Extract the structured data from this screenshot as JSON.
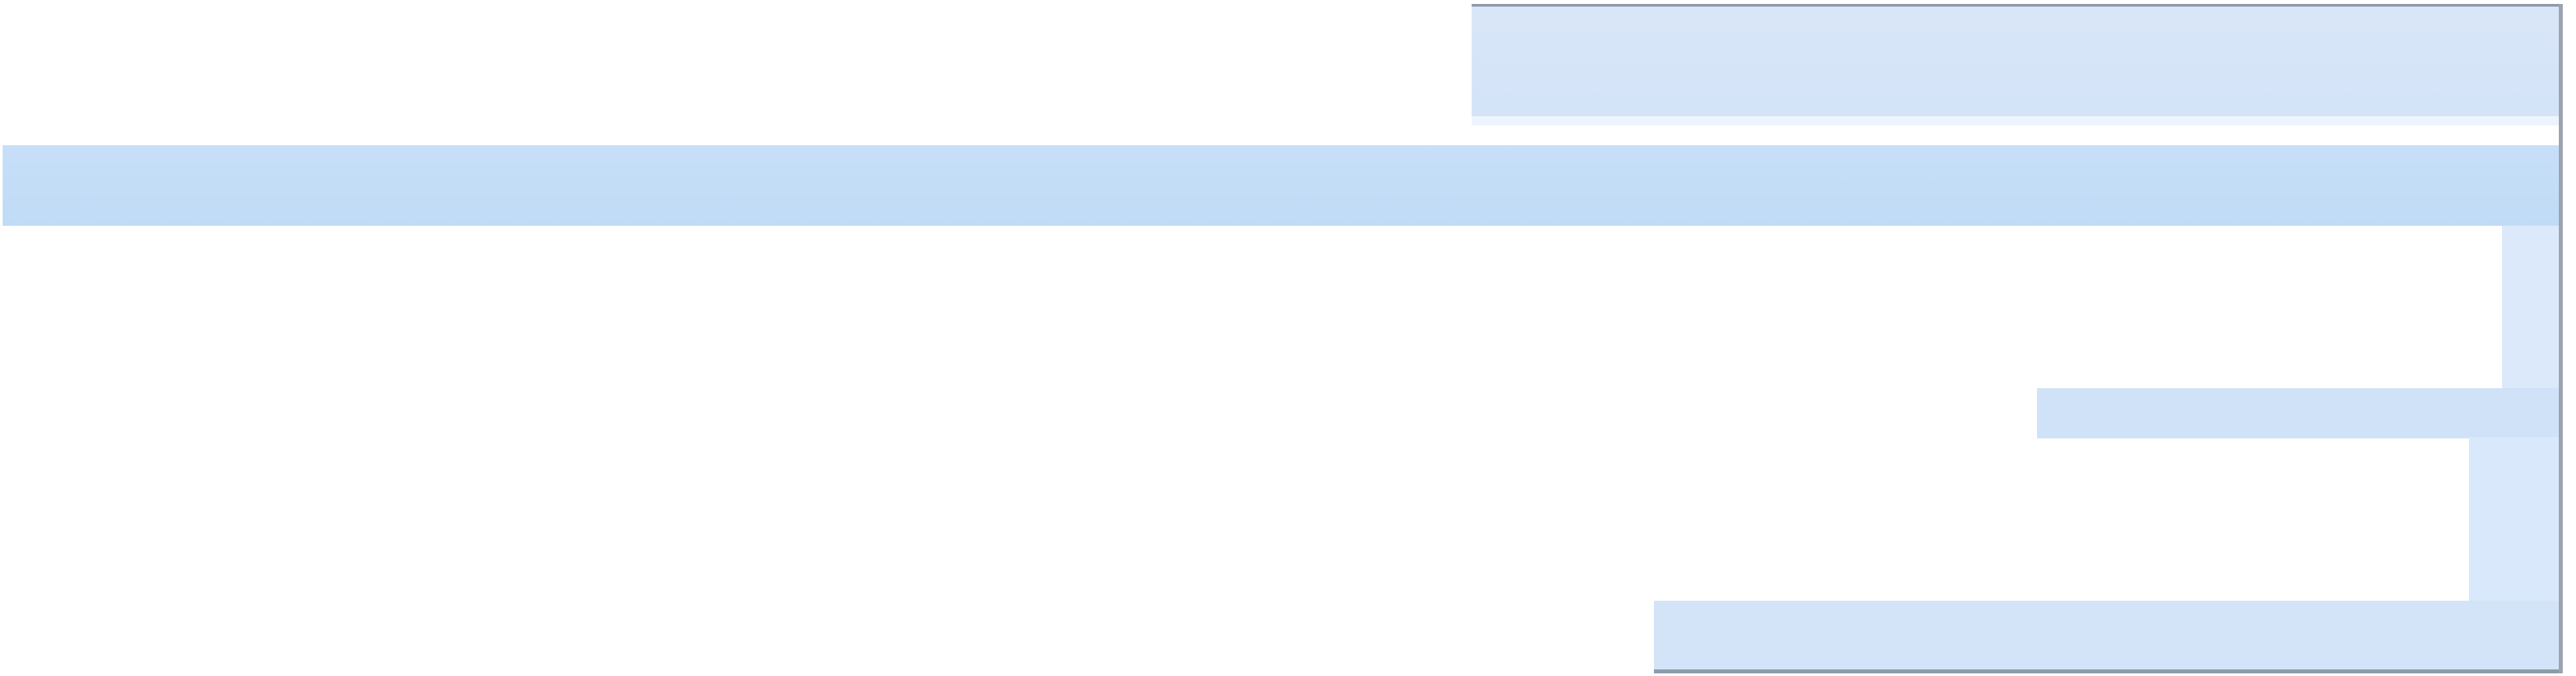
{
  "window": {
    "title": "",
    "accent_color": "#c7dff8",
    "frame_color": "#8f9aa8"
  },
  "header": {
    "title": ""
  },
  "list": {
    "selected_item_label": ""
  }
}
